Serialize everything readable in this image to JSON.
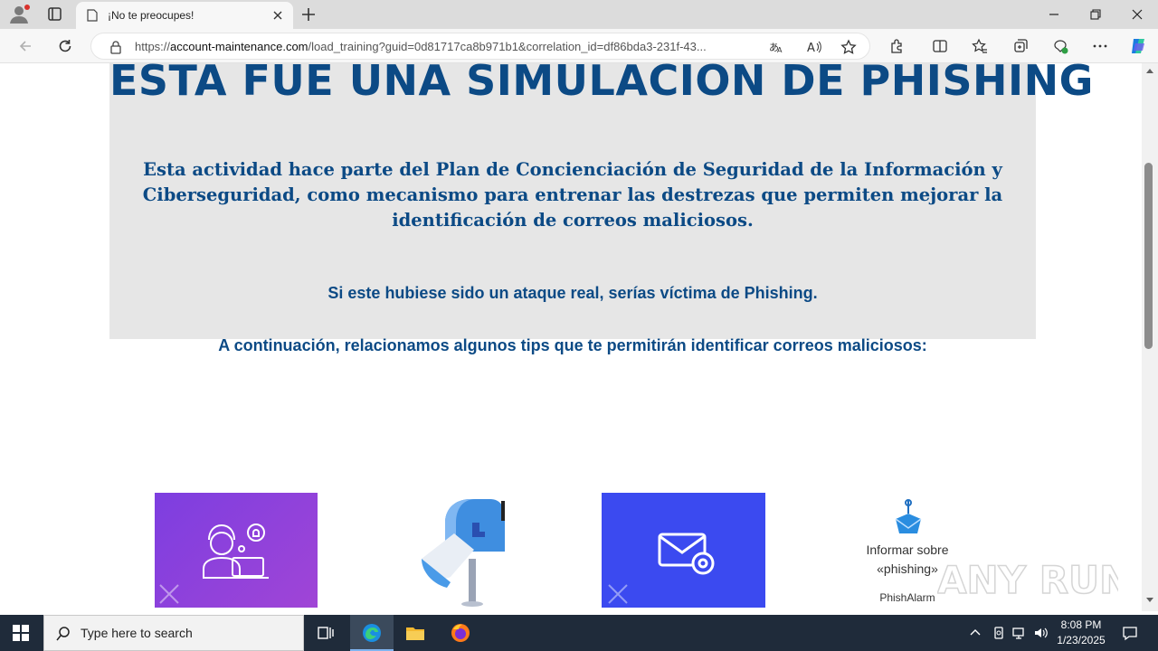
{
  "browser": {
    "tab_title": "¡No te preocupes!",
    "url_prefix": "https://",
    "url_host": "account-maintenance.com",
    "url_path": "/load_training?guid=0d81717ca8b971b1&correlation_id=df86bda3-231f-43..."
  },
  "page": {
    "heading": "ESTA FUE UNA SIMULACIÓN DE PHISHING",
    "paragraph": "Esta actividad hace parte del Plan de Concienciación de Seguridad de la Información y Ciberseguridad, como mecanismo para entrenar las destrezas que permiten mejorar la identificación de correos maliciosos.",
    "warning": "Si este hubiese sido un ataque real, serías víctima de Phishing.",
    "tips_intro": "A continuación, relacionamos algunos tips que te permitirán identificar correos maliciosos:",
    "phish_card": {
      "line1": "Informar sobre",
      "line2": "«phishing»",
      "brand": "PhishAlarm"
    },
    "watermark": "ANY RUN"
  },
  "taskbar": {
    "search_placeholder": "Type here to search",
    "time": "8:08 PM",
    "date": "1/23/2025"
  },
  "colors": {
    "heading": "#0c4a85",
    "banner_bg": "#e6e6e6",
    "card_purple": "#8a40dc",
    "card_blue": "#3b4af0"
  }
}
